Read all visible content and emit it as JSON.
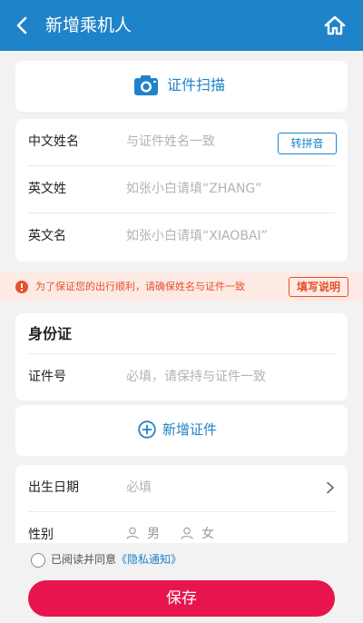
{
  "header": {
    "title": "新增乘机人",
    "back_icon": "back-arrow-icon",
    "home_icon": "home-icon",
    "bg_color": "#1f83c9"
  },
  "scan": {
    "label": "证件扫描",
    "icon": "camera-icon"
  },
  "names": {
    "chinese_name": {
      "label": "中文姓名",
      "placeholder": "与证件姓名一致",
      "button": "转拼音"
    },
    "english_surname": {
      "label": "英文姓",
      "placeholder": "如张小白请填“ZHANG”"
    },
    "english_given": {
      "label": "英文名",
      "placeholder": "如张小白请填“XIAOBAI”"
    }
  },
  "notice": {
    "text": "为了保证您的出行顺利，请确保姓名与证件一致",
    "button": "填写说明",
    "icon": "warning-icon",
    "color": "#e5512b"
  },
  "id": {
    "type": "身份证",
    "number_label": "证件号",
    "number_placeholder": "必填，请保持与证件一致"
  },
  "add_cert": {
    "label": "新增证件",
    "icon": "plus-circle-icon"
  },
  "birth": {
    "label": "出生日期",
    "placeholder": "必填",
    "icon": "chevron-right-icon"
  },
  "gender": {
    "label": "性别",
    "male": "男",
    "female": "女"
  },
  "agreement": {
    "text": "已阅读并同意",
    "link": "《隐私通知》"
  },
  "save": {
    "label": "保存",
    "color": "#e8144e"
  }
}
